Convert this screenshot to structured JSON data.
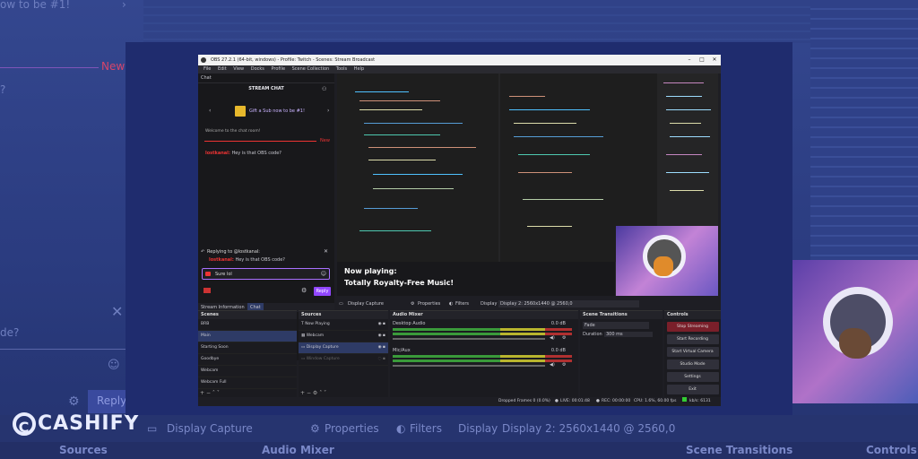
{
  "background": {
    "chat_gift_text": "ow to be #1!",
    "new_label": "New",
    "question_mark": "?",
    "de_text": "de?",
    "close_icon": "close-icon",
    "reply_label": "Reply",
    "bottom_bar": {
      "display_capture": "Display Capture",
      "properties": "Properties",
      "filters": "Filters",
      "display": "Display",
      "display_value": "Display 2: 2560x1440 @ 2560,0",
      "sources": "Sources",
      "audio_mixer": "Audio Mixer",
      "scene_transitions": "Scene Transitions",
      "controls": "Controls"
    }
  },
  "brand": {
    "name": "CASHIFY",
    "letter": "C"
  },
  "obs": {
    "title": "OBS 27.2.1 (64-bit, windows) - Profile: Twitch - Scenes: Stream Broadcast",
    "menu": [
      "File",
      "Edit",
      "View",
      "Docks",
      "Profile",
      "Scene Collection",
      "Tools",
      "Help"
    ],
    "chat": {
      "dock_title": "Chat",
      "header": "STREAM CHAT",
      "gift_text": "Gift a Sub now to be #1!",
      "welcome": "Welcome to the chat room!",
      "new_label": "New",
      "message_user": "lostkanal:",
      "message_text": "Hey is that OBS code?",
      "replying_to": "Replying to @lostkanal:",
      "reply_user": "lostkanal:",
      "reply_text": "Hey is that OBS code?",
      "input_value": "Sure lol",
      "reply_button": "Reply",
      "tab_stream_info": "Stream Information",
      "tab_chat": "Chat"
    },
    "now_playing": {
      "line1": "Now playing:",
      "line2": "Totally Royalty-Free Music!"
    },
    "source_bar": {
      "source": "Display Capture",
      "properties": "Properties",
      "filters": "Filters",
      "display": "Display",
      "display_value": "Display 2: 2560x1440 @ 2560,0"
    },
    "scenes": {
      "title": "Scenes",
      "items": [
        "BRB",
        "Main",
        "Starting Soon",
        "Goodbye",
        "Webcam",
        "Webcam Full"
      ]
    },
    "sources": {
      "title": "Sources",
      "items": [
        "Now Playing",
        "Webcam",
        "Display Capture",
        "Window Capture"
      ]
    },
    "audio": {
      "title": "Audio Mixer",
      "channels": [
        {
          "name": "Desktop Audio",
          "db": "0.0 dB"
        },
        {
          "name": "Mic/Aux",
          "db": "0.0 dB"
        }
      ]
    },
    "transitions": {
      "title": "Scene Transitions",
      "type": "Fade",
      "duration_label": "Duration",
      "duration": "300 ms"
    },
    "controls": {
      "title": "Controls",
      "buttons": [
        "Stop Streaming",
        "Start Recording",
        "Start Virtual Camera",
        "Studio Mode",
        "Settings",
        "Exit"
      ]
    },
    "status": {
      "dropped": "Dropped Frames 0 (0.0%)",
      "live": "LIVE: 00:01:48",
      "rec": "REC: 00:00:00",
      "cpu": "CPU: 1.6%, 60.00 fps",
      "kbps": "kb/s: 6131"
    }
  }
}
